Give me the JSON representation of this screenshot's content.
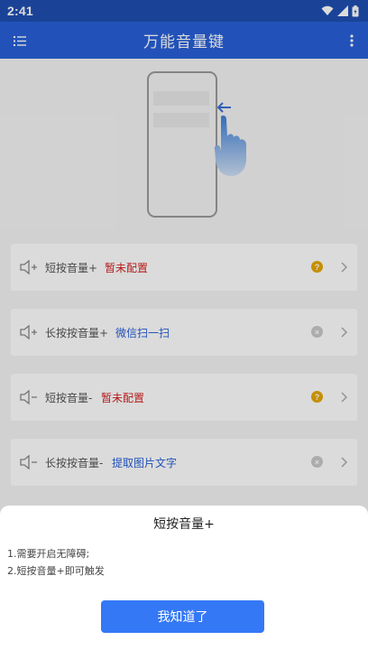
{
  "status_bar": {
    "time": "2:41"
  },
  "app_bar": {
    "title": "万能音量键"
  },
  "colors": {
    "app_bar": "#2860d8",
    "accent_red": "#d62020",
    "accent_blue": "#2860d8",
    "warn_badge": "#e6a700",
    "button": "#3478f6"
  },
  "cards": [
    {
      "label": "短按音量+",
      "value": "暂未配置",
      "value_color": "red",
      "badge": "warn",
      "badge_glyph": "?"
    },
    {
      "label": "长按按音量+",
      "value": "微信扫一扫",
      "value_color": "blue",
      "badge": "clear",
      "badge_glyph": "×"
    },
    {
      "label": "短按音量-",
      "value": "暂未配置",
      "value_color": "red",
      "badge": "warn",
      "badge_glyph": "?"
    },
    {
      "label": "长按按音量-",
      "value": "提取图片文字",
      "value_color": "blue",
      "badge": "clear",
      "badge_glyph": "×"
    }
  ],
  "sheet": {
    "title": "短按音量+",
    "line1": "1.需要开启无障碍;",
    "line2": "2.短按音量+即可触发",
    "button_label": "我知道了"
  }
}
